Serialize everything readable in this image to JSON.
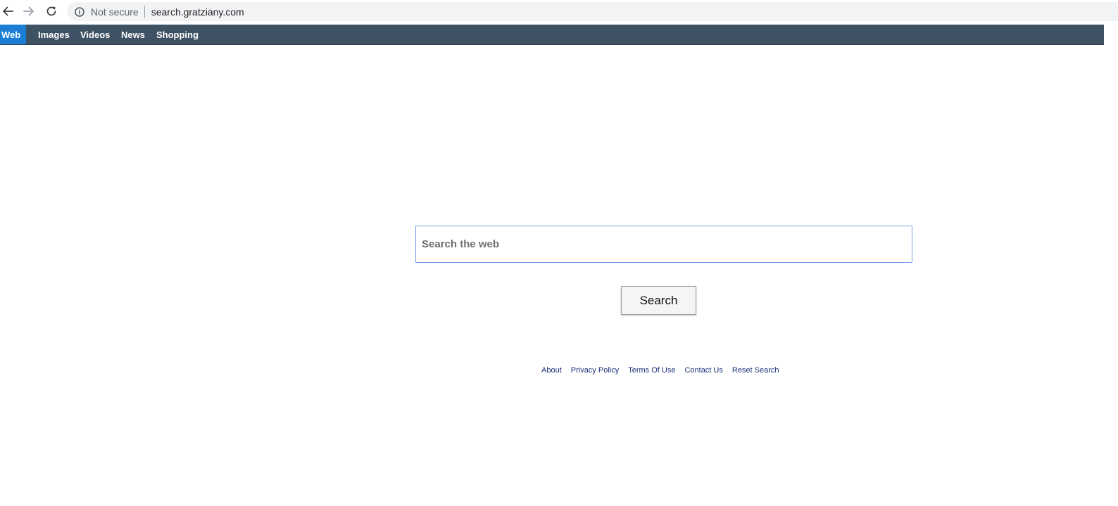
{
  "browser": {
    "security_label": "Not secure",
    "url": "search.gratziany.com",
    "icons": [
      "back-arrow-icon",
      "forward-arrow-icon",
      "reload-icon",
      "info-icon"
    ]
  },
  "topnav": {
    "tabs": [
      {
        "label": "Web",
        "active": true
      },
      {
        "label": "Images"
      },
      {
        "label": "Videos"
      },
      {
        "label": "News"
      },
      {
        "label": "Shopping"
      }
    ],
    "background_color": "#3e5263",
    "active_color": "#1a7fd4"
  },
  "search": {
    "placeholder": "Search the web",
    "button_label": "Search"
  },
  "footer": {
    "links": [
      "About",
      "Privacy Policy",
      "Terms Of Use",
      "Contact Us",
      "Reset Search"
    ],
    "link_color": "#1a2f7a"
  }
}
